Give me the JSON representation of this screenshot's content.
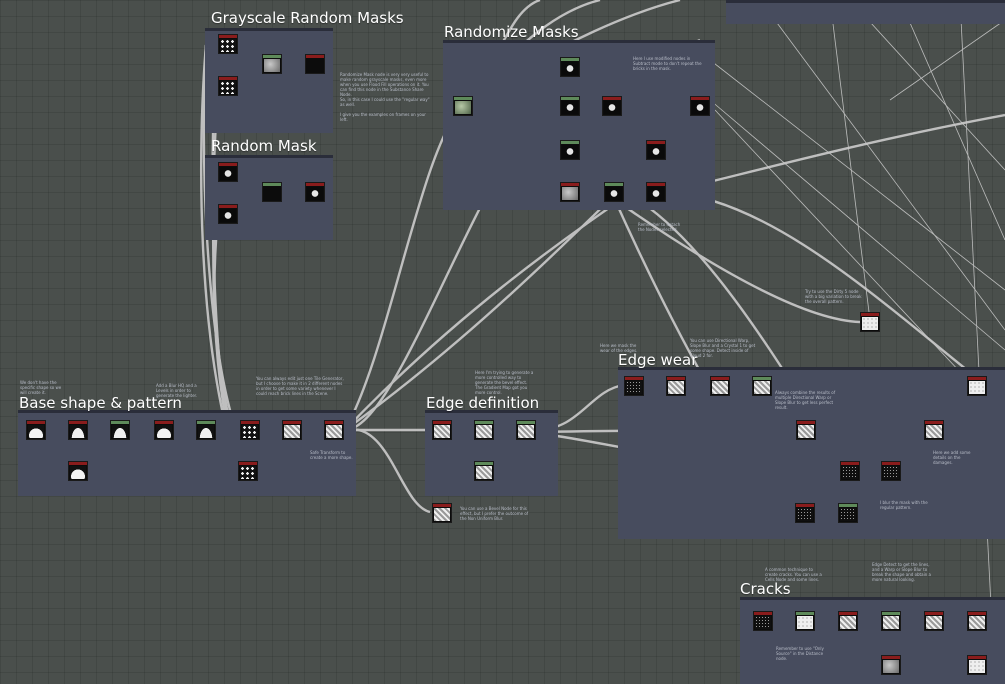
{
  "frames": [
    {
      "title": "Grayscale Random Masks"
    },
    {
      "title": "Random Mask"
    },
    {
      "title": "Randomize Masks"
    },
    {
      "title": "Base shape & pattern"
    },
    {
      "title": "Edge definition"
    },
    {
      "title": "Edge wear"
    },
    {
      "title": "Cracks"
    }
  ],
  "notes": [
    "Randomize Mask node is very very useful to make random grayscale masks, even more when you use Flood Fill operations on it. You can find this node in the Substance Share Node.",
    "So, in this case I could use the \"regular way\" as well.",
    "I give you the examples on frames on your left.",
    "Here I use modified nodes in Subtract mode to don't repeat the bricks in the mask.",
    "Remember to detach the Nodes selected.",
    "Try to use the Dirty 5 node with a big variation to break the overall pattern.",
    "We don't have the specific shape so we will create it.",
    "Add a Blur HQ and a Levels in order to generate the lighter.",
    "You can always edit just one Tile Generator, but I choose to make it in 2 different nodes in order to get some variety whenever I could reach brick lines in the Scene.",
    "Safe Transform to create a more shape.",
    "Here I'm trying to generate a more controlled way to generate the bevel effect. The Gradient Map got you more control.",
    "You can use a Bevel Node for this effect, but I prefer the outcome of the Non Uniform Blur.",
    "Here we mask the wear of the edges.",
    "You can use Directional Warp, Slope Blur and a Crystal 1 to get some shape. Detect inside of Cloud 2 for.",
    "Always combine the results of multiple Directional Warp or Slope Blur to get less perfect result.",
    "Here we add some details on the damages.",
    "I blur the mask with the regular pattern.",
    "A common technique to create cracks. You can use a Cells Node and some lines.",
    "Edge Detect to get the lines, and a Warp or Slope Blur to break the shape and obtain a more natural looking.",
    "Remember to use \"Only Source\" in the Distance node."
  ]
}
